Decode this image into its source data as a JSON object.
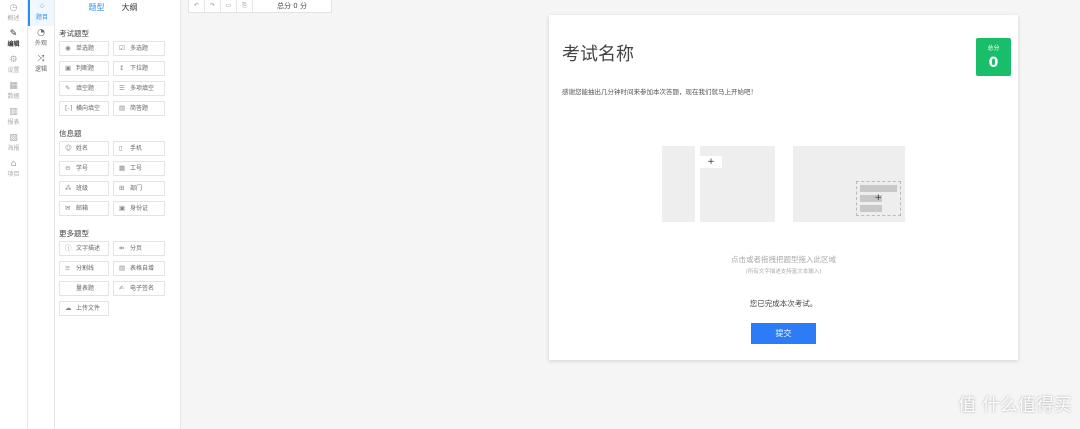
{
  "nav_primary": [
    {
      "icon": "dashboard-icon",
      "glyph": "◷",
      "label": "概述"
    },
    {
      "icon": "edit-icon",
      "glyph": "✎",
      "label": "编辑",
      "active": true
    },
    {
      "icon": "gear-icon",
      "glyph": "⚙",
      "label": "设置"
    },
    {
      "icon": "table-icon",
      "glyph": "▦",
      "label": "数据"
    },
    {
      "icon": "report-icon",
      "glyph": "▥",
      "label": "报表"
    },
    {
      "icon": "image-icon",
      "glyph": "▨",
      "label": "海报"
    },
    {
      "icon": "home-icon",
      "glyph": "⌂",
      "label": "项目"
    }
  ],
  "nav_secondary": [
    {
      "icon": "grid-icon",
      "glyph": "⁘",
      "label": "题目",
      "active": true
    },
    {
      "icon": "palette-icon",
      "glyph": "◔",
      "label": "外观"
    },
    {
      "icon": "shuffle-icon",
      "glyph": "⤨",
      "label": "逻辑"
    }
  ],
  "panel": {
    "tabs": [
      "题型",
      "大纲"
    ],
    "sections": [
      {
        "title": "考试题型",
        "items": [
          {
            "g": "◉",
            "l": "单选题"
          },
          {
            "g": "☑",
            "l": "多选题"
          },
          {
            "g": "▣",
            "l": "判断题"
          },
          {
            "g": "↕",
            "l": "下拉题"
          },
          {
            "g": "✎",
            "l": "填空题"
          },
          {
            "g": "☰",
            "l": "多项填空"
          },
          {
            "g": "[-]",
            "l": "横向填空"
          },
          {
            "g": "▤",
            "l": "简答题"
          }
        ]
      },
      {
        "title": "信息题",
        "items": [
          {
            "g": "☺",
            "l": "姓名"
          },
          {
            "g": "▯",
            "l": "手机"
          },
          {
            "g": "⊖",
            "l": "学号"
          },
          {
            "g": "▦",
            "l": "工号"
          },
          {
            "g": "⁂",
            "l": "班级"
          },
          {
            "g": "⊞",
            "l": "部门"
          },
          {
            "g": "✉",
            "l": "邮箱"
          },
          {
            "g": "▣",
            "l": "身份证"
          }
        ]
      },
      {
        "title": "更多题型",
        "items": [
          {
            "g": "ⓘ",
            "l": "文字描述"
          },
          {
            "g": "⇹",
            "l": "分页"
          },
          {
            "g": "≡",
            "l": "分割线"
          },
          {
            "g": "▤",
            "l": "表格自增"
          },
          {
            "g": "",
            "l": "量表题"
          },
          {
            "g": "✍",
            "l": "电子签名"
          },
          {
            "g": "☁",
            "l": "上传文件"
          }
        ]
      }
    ]
  },
  "toolbar": {
    "undo": "↶",
    "redo": "↷",
    "preview": "▭",
    "export": "⎘",
    "score": "总分 0 分"
  },
  "exam": {
    "title": "考试名称",
    "total_label": "总分",
    "total_value": "0",
    "intro": "感谢您能抽出几分钟时间来参加本次答题，现在我们就马上开始吧！",
    "drop_hint": "点击或者拖拽把题型拖入此区域",
    "drop_sub": "(所有文字描述支持富文本输入)",
    "done": "您已完成本次考试。",
    "submit": "提交"
  },
  "watermark": "值 什么值得买"
}
